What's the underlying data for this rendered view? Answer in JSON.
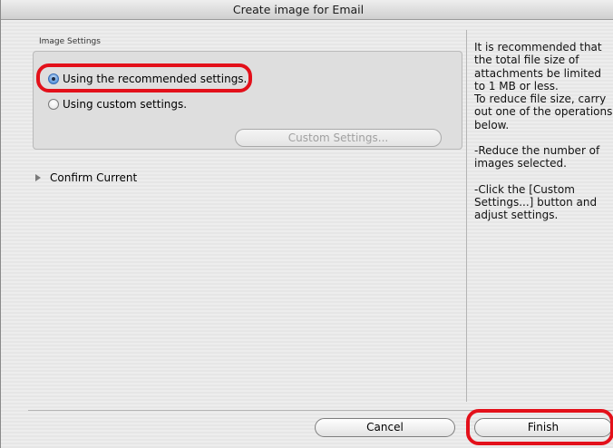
{
  "window": {
    "title": "Create image for Email"
  },
  "image_settings": {
    "group_label": "Image Settings",
    "options": [
      {
        "label": "Using the recommended settings.",
        "selected": true
      },
      {
        "label": "Using custom settings.",
        "selected": false
      }
    ],
    "custom_settings_button": "Custom Settings..."
  },
  "confirm_current": {
    "label": "Confirm Current"
  },
  "info_panel": {
    "paragraphs": [
      "It is recommended that the total file size of attachments be limited to 1 MB or less.\nTo reduce file size, carry out one of the operations below.",
      "-Reduce the number of images selected.",
      "-Click the [Custom Settings...] button and adjust settings."
    ]
  },
  "footer": {
    "cancel_label": "Cancel",
    "finish_label": "Finish"
  },
  "colors": {
    "highlight": "#e3101a",
    "radio_selected": "#5c97dd"
  }
}
